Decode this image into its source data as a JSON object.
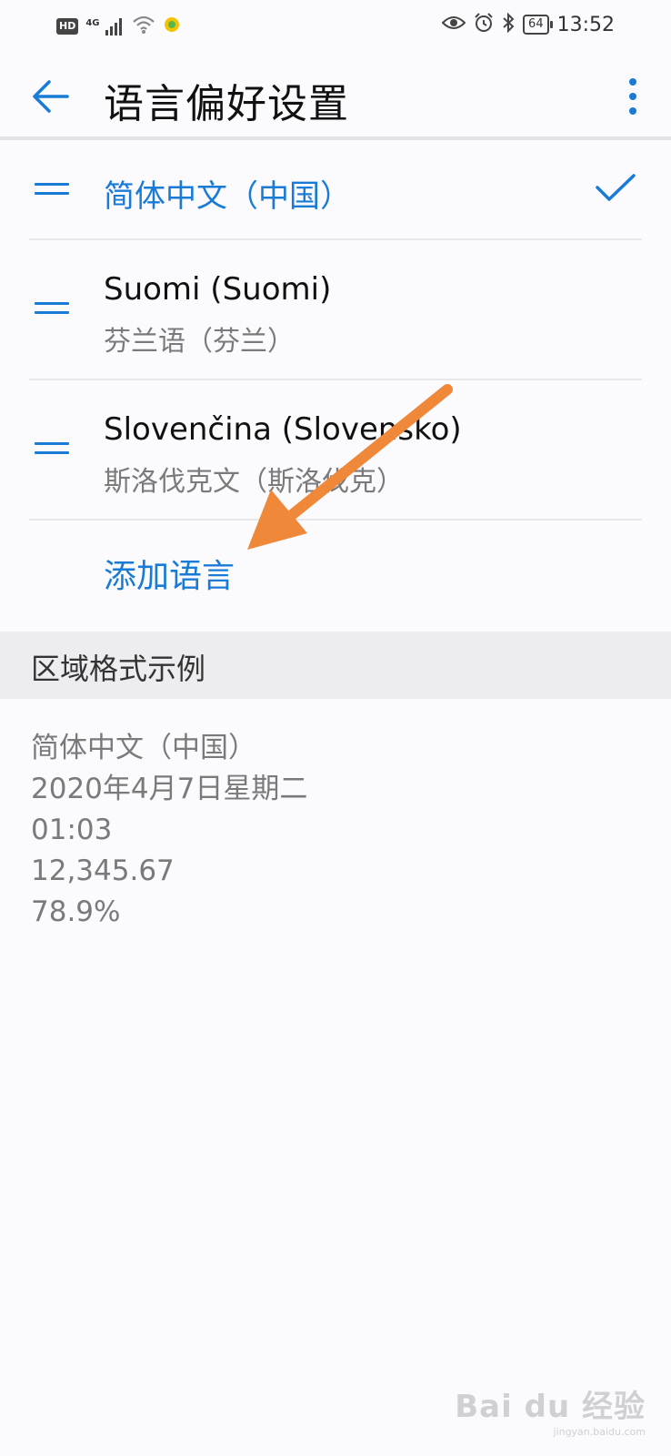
{
  "status_bar": {
    "hd": "HD",
    "network": "4G",
    "battery": "64",
    "time": "13:52",
    "icons": [
      "signal-icon",
      "wifi-icon",
      "app-notification-icon",
      "eye-icon",
      "alarm-icon",
      "bluetooth-icon",
      "battery-icon"
    ]
  },
  "header": {
    "title": "语言偏好设置",
    "back_icon": "arrow-left-icon",
    "more_icon": "more-vertical-icon"
  },
  "languages": [
    {
      "title": "简体中文（中国）",
      "subtitle": "",
      "selected": true
    },
    {
      "title": "Suomi (Suomi)",
      "subtitle": "芬兰语（芬兰）",
      "selected": false
    },
    {
      "title": "Slovenčina (Slovensko)",
      "subtitle": "斯洛伐克文（斯洛伐克）",
      "selected": false
    }
  ],
  "add_language": "添加语言",
  "region": {
    "section_title": "区域格式示例",
    "samples": [
      "简体中文（中国）",
      "2020年4月7日星期二",
      "01:03",
      "12,345.67",
      "78.9%"
    ]
  },
  "watermark": {
    "logo": "Bai du 经验",
    "url": "jingyan.baidu.com"
  },
  "colors": {
    "accent": "#1a7bd6",
    "annotation": "#f0883a",
    "background": "#fbfafd"
  }
}
